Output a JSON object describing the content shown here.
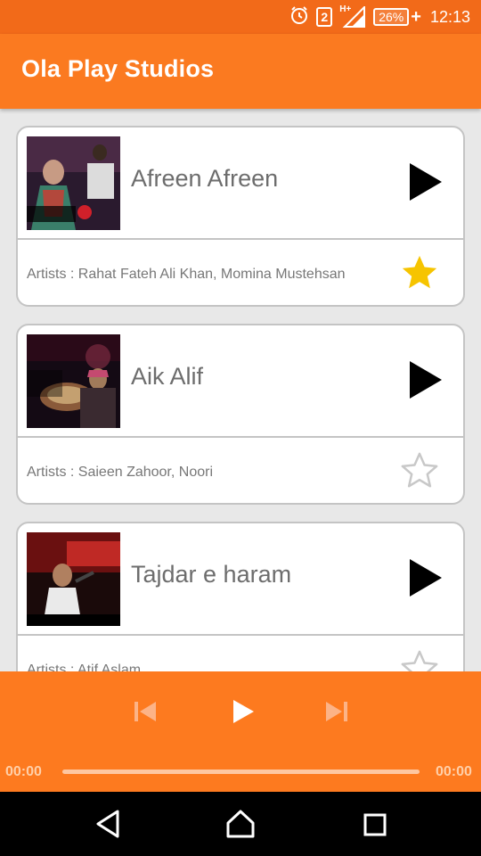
{
  "status_bar": {
    "sim_slot": "2",
    "network": "H+",
    "battery_percent": "26%",
    "time": "12:13",
    "icons": [
      "alarm-icon",
      "signal-icon",
      "battery-icon"
    ]
  },
  "app": {
    "title": "Ola Play Studios",
    "accent_color": "#fb7a20",
    "star_active_color": "#f6c400"
  },
  "songs": [
    {
      "title": "Afreen Afreen",
      "artists_label": "Artists :",
      "artists": "Rahat Fateh Ali Khan, Momina Mustehsan",
      "favorite": true
    },
    {
      "title": "Aik Alif",
      "artists_label": "Artists :",
      "artists": "Saieen Zahoor, Noori",
      "favorite": false
    },
    {
      "title": "Tajdar e haram",
      "artists_label": "Artists :",
      "artists": "Atif Aslam",
      "favorite": false
    }
  ],
  "player": {
    "elapsed": "00:00",
    "duration": "00:00",
    "progress": 0
  },
  "nav": [
    "back-icon",
    "home-icon",
    "recents-icon"
  ]
}
